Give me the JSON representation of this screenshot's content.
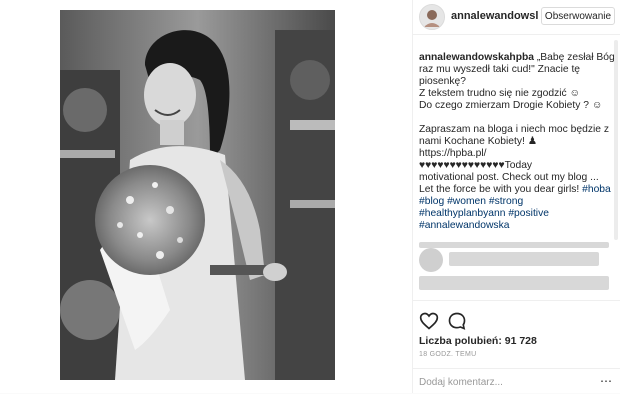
{
  "post": {
    "username": "annalewandowsl",
    "follow_label": "Obserwowanie",
    "caption": {
      "author": "annalewandowskahpba",
      "line1_rest": " „Babę zesłał Bóg,",
      "line2": "raz mu wyszedł taki cud!\" Znacie tę",
      "line3": "piosenkę?",
      "line4": "Z tekstem trudno się nie zgodzić ☺",
      "line5": "Do czego zmierzam Drogie Kobiety ? ☺",
      "line6": "Zapraszam na bloga i niech moc będzie z",
      "line7": "nami Kochane Kobiety! ♟",
      "line8": "https://hpba.pl/",
      "line9": "♥♥♥♥♥♥♥♥♥♥♥♥♥♥Today",
      "line10": "motivational post. Check out my blog ...",
      "line11_text": "Let the force be with you dear girls! ",
      "tag_hoba": "#hoba",
      "tag_blog": "#blog",
      "tag_women": "#women",
      "tag_strong": "#strong",
      "tag_healthy": "#healthyplanbyann",
      "tag_positive": "#positive",
      "tag_annalewandowska": "#annalewandowska"
    },
    "likes": "Liczba polubień: 91 728",
    "timestamp": "18 GODZ. TEMU",
    "comment_placeholder": "Dodaj komentarz...",
    "icons": {
      "like": "heart-icon",
      "comment": "comment-icon",
      "more": "more-options-icon"
    }
  }
}
